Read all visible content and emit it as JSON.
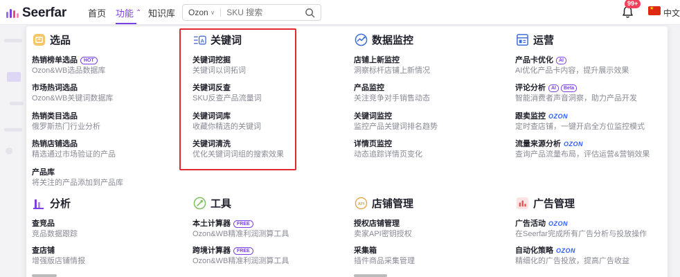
{
  "brand": {
    "name": "Seerfar"
  },
  "nav": {
    "home": "首页",
    "features": "功能",
    "knowledge": "知识库"
  },
  "search": {
    "site": "Ozon",
    "placeholder": "SKU 搜索"
  },
  "notifications": {
    "badge": "99+"
  },
  "language": {
    "label": "中文"
  },
  "colors": {
    "accent": "#7b3fe4",
    "highlight_box": "#e0282e",
    "ozon": "#2e5bff"
  },
  "sections": {
    "selection": {
      "title": "选品",
      "icon": "box-icon",
      "items": [
        {
          "title": "热销榜单选品",
          "tag": "HOT",
          "desc": "Ozon&WB选品数据库"
        },
        {
          "title": "市场热词选品",
          "desc": "Ozon&WB关键词数据库"
        },
        {
          "title": "热销类目选品",
          "desc": "俄罗斯热门行业分析"
        },
        {
          "title": "热销店铺选品",
          "desc": "精选通过市场验证的产品"
        },
        {
          "title": "产品库",
          "desc": "将关注的产品添加到产品库"
        }
      ]
    },
    "keywords": {
      "title": "关键词",
      "icon": "keyword-icon",
      "items": [
        {
          "title": "关键词挖掘",
          "desc": "关键词以词拓词"
        },
        {
          "title": "关键词反查",
          "desc": "SKU反查产品流量词"
        },
        {
          "title": "关键词词库",
          "desc": "收藏你精选的关键词"
        },
        {
          "title": "关键词清洗",
          "desc": "优化关键词词组的搜索效果"
        }
      ]
    },
    "monitoring": {
      "title": "数据监控",
      "icon": "monitor-icon",
      "items": [
        {
          "title": "店铺上新监控",
          "desc": "洞察标杆店铺上新情况"
        },
        {
          "title": "产品监控",
          "desc": "关注竞争对手销售动态"
        },
        {
          "title": "关键词监控",
          "desc": "监控产品关键词排名趋势"
        },
        {
          "title": "详情页监控",
          "desc": "动态追踪详情页变化"
        }
      ]
    },
    "operations": {
      "title": "运营",
      "icon": "operations-icon",
      "items": [
        {
          "title": "产品卡优化",
          "tags": [
            "AI"
          ],
          "desc": "AI优化产品卡内容，提升展示效果"
        },
        {
          "title": "评论分析",
          "tags": [
            "AI",
            "Beta"
          ],
          "desc": "智能消费者声音洞察，助力产品开发"
        },
        {
          "title": "跟卖监控",
          "tags": [
            "OZON"
          ],
          "desc": "定时查店铺，一键开启全方位监控模式"
        },
        {
          "title": "流量来源分析",
          "tags": [
            "OZON"
          ],
          "desc": "查询产品流量布局，评估运营&营销效果"
        }
      ]
    },
    "analysis": {
      "title": "分析",
      "icon": "bar-chart-icon",
      "items": [
        {
          "title": "查竞品",
          "desc": "竞品数据跟踪"
        },
        {
          "title": "查店铺",
          "desc": "增强版店铺情报"
        },
        {
          "title": "",
          "desc": ""
        }
      ]
    },
    "tools": {
      "title": "工具",
      "icon": "tool-icon",
      "items": [
        {
          "title": "本土计算器",
          "tag": "FREE",
          "desc": "Ozon&WB精准利润测算工具"
        },
        {
          "title": "跨境计算器",
          "tag": "FREE",
          "desc": "Ozon&WB精准利润测算工具"
        }
      ]
    },
    "stores": {
      "title": "店铺管理",
      "icon": "api-icon",
      "items": [
        {
          "title": "授权店铺管理",
          "desc": "卖家API密钥授权"
        },
        {
          "title": "采集箱",
          "desc": "插件商品采集管理"
        }
      ]
    },
    "ads": {
      "title": "广告管理",
      "icon": "ad-chart-icon",
      "items": [
        {
          "title": "广告活动",
          "tags": [
            "OZON"
          ],
          "desc": "在Seerfar完成所有广告分析与投放操作"
        },
        {
          "title": "自动化策略",
          "tags": [
            "OZON"
          ],
          "desc": "精细化的广告投放，提高广告收益"
        }
      ]
    }
  }
}
